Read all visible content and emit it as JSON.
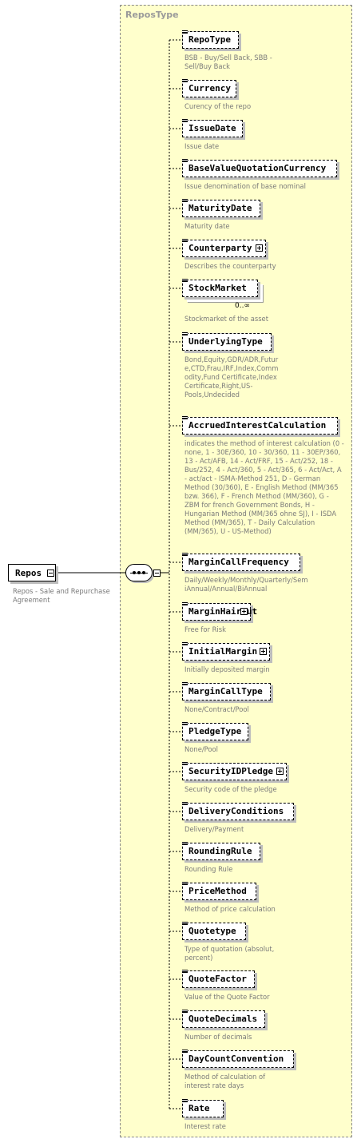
{
  "type_name": "ReposType",
  "root": {
    "label": "Repos",
    "description": "Repos - Sale and Repurchase Agreement"
  },
  "elements": [
    {
      "name": "RepoType",
      "desc": "BSB - Buy/Sell Back, SBB - Sell/Buy Back",
      "plus": false,
      "multi": false
    },
    {
      "name": "Currency",
      "desc": "Curency of the repo",
      "plus": false,
      "multi": false
    },
    {
      "name": "IssueDate",
      "desc": "Issue date",
      "plus": false,
      "multi": false
    },
    {
      "name": "BaseValueQuotationCurrency",
      "desc": "Issue denomination of base nominal",
      "plus": false,
      "multi": false
    },
    {
      "name": "MaturityDate",
      "desc": "Maturity date",
      "plus": false,
      "multi": false
    },
    {
      "name": "Counterparty",
      "desc": "Describes the counterparty",
      "plus": true,
      "multi": false
    },
    {
      "name": "StockMarket",
      "desc": "Stockmarket of the asset",
      "plus": false,
      "multi": true,
      "cardinality": "0..∞"
    },
    {
      "name": "UnderlyingType",
      "desc": "Bond,Equity,GDR/ADR,Future,CTD,Frau,IRF,Index,Commodity,Fund Certificate,Index Certificate,Right,US-Pools,Undecided",
      "plus": false,
      "multi": false
    },
    {
      "name": "AccruedInterestCalculation",
      "desc": "indicates the method of interest calculation (0 - none, 1 - 30E/360, 10 - 30/360, 11 - 30EP/360, 13 - Act/AFB, 14 - Act/FRF, 15 - Act/252, 18 - Bus/252, 4 - Act/360, 5 - Act/365, 6 - Act/Act, A - act/act - ISMA-Method 251, D - German Method (30/360), E - English Method (MM/365 bzw. 366), F - French Method (MM/360), G - ZBM for french Government Bonds, H - Hungarian Method (MM/365 ohne SJ), I - ISDA Method (MM/365), T - Daily Calculation (MM/365), U - US-Method)",
      "plus": false,
      "multi": false
    },
    {
      "name": "MarginCallFrequency",
      "desc": "Daily/Weekly/Monthly/Quarterly/SemiAnnual/Annual/BiAnnual",
      "plus": false,
      "multi": false
    },
    {
      "name": "MarginHaircut",
      "desc": "Free for Risk",
      "plus": true,
      "multi": false
    },
    {
      "name": "InitialMargin",
      "desc": "Initially deposited margin",
      "plus": true,
      "multi": false
    },
    {
      "name": "MarginCallType",
      "desc": "None/Contract/Pool",
      "plus": false,
      "multi": false
    },
    {
      "name": "PledgeType",
      "desc": "None/Pool",
      "plus": false,
      "multi": false
    },
    {
      "name": "SecurityIDPledge",
      "desc": "Security code of the pledge",
      "plus": true,
      "multi": false
    },
    {
      "name": "DeliveryConditions",
      "desc": "Delivery/Payment",
      "plus": false,
      "multi": false
    },
    {
      "name": "RoundingRule",
      "desc": "Rounding Rule",
      "plus": false,
      "multi": false
    },
    {
      "name": "PriceMethod",
      "desc": "Method of price calculation",
      "plus": false,
      "multi": false
    },
    {
      "name": "Quotetype",
      "desc": "Type of quotation (absolut, percent)",
      "plus": false,
      "multi": false
    },
    {
      "name": "QuoteFactor",
      "desc": "Value of the Quote Factor",
      "plus": false,
      "multi": false
    },
    {
      "name": "QuoteDecimals",
      "desc": "Number of decimals",
      "plus": false,
      "multi": false
    },
    {
      "name": "DayCountConvention",
      "desc": "Method of calculation of interest rate days",
      "plus": false,
      "multi": false
    },
    {
      "name": "Rate",
      "desc": "Interest rate",
      "plus": false,
      "multi": false
    }
  ]
}
